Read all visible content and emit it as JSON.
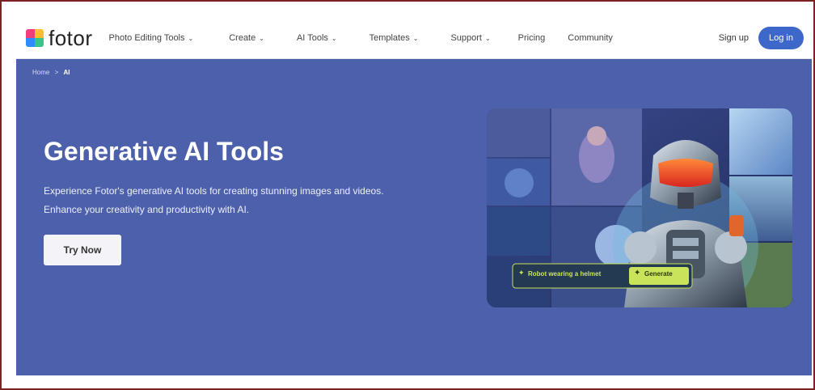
{
  "logo": {
    "text": "fotor"
  },
  "nav": {
    "items": [
      {
        "label": "Photo Editing Tools",
        "dropdown": true
      },
      {
        "label": "Create",
        "dropdown": true
      },
      {
        "label": "AI Tools",
        "dropdown": true
      },
      {
        "label": "Templates",
        "dropdown": true
      },
      {
        "label": "Support",
        "dropdown": true
      },
      {
        "label": "Pricing",
        "dropdown": false
      },
      {
        "label": "Community",
        "dropdown": false
      }
    ],
    "signup": "Sign up",
    "login": "Log in"
  },
  "breadcrumb": {
    "home": "Home",
    "sep": ">",
    "current": "AI"
  },
  "hero": {
    "title": "Generative AI Tools",
    "description": "Experience Fotor's generative AI tools for creating stunning images and videos. Enhance your creativity and productivity with AI.",
    "cta": "Try Now"
  },
  "prompt_widget": {
    "text": "Robot wearing a helmet",
    "button": "Generate"
  },
  "colors": {
    "hero_bg": "#4c60ab",
    "login_bg": "#3d67c9",
    "generate_bg": "#c9e35a",
    "prompt_text": "#c9e35a",
    "frame_border": "#7a2222"
  },
  "icons": {
    "chevron": "chevron-down-icon",
    "spark": "sparkle-icon",
    "wand": "magic-wand-icon"
  }
}
